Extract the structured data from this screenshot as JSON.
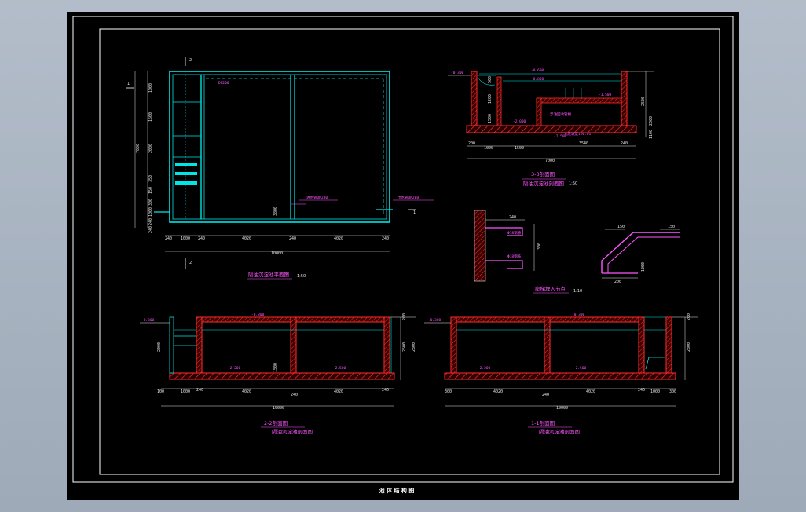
{
  "sheet": {
    "title": "池 体 结 构 图",
    "background": "#000000",
    "viewport_bg": "#a9b4c2"
  },
  "colors": {
    "wall": "#ff2b2b",
    "cyan": "#00e5e5",
    "magenta": "#ff55ff",
    "dim": "#e6e6e6",
    "frame": "#ffffff"
  },
  "plan": {
    "title": "隔油沉淀池平面图",
    "scale": "1:50",
    "section_marks": [
      "2",
      "2",
      "1",
      "1"
    ],
    "dims_bottom": [
      "240",
      "1000",
      "240",
      "4020",
      "240",
      "4020",
      "240"
    ],
    "total_width": "10000",
    "dims_left": [
      "1000",
      "1500",
      "2000",
      "350",
      "150",
      "300",
      "1000",
      "240",
      "240"
    ],
    "total_height": "7000",
    "annotations": [
      "DN200",
      "3800",
      "进水管DN200",
      "出水管DN200"
    ]
  },
  "section3": {
    "title": "3-3剖面图",
    "subtitle": "隔油沉淀池剖面图",
    "scale": "1:50",
    "dims_bottom": [
      "200",
      "1000",
      "1500",
      "3540",
      "240"
    ],
    "total_width": "7000",
    "dims_right": [
      "2500",
      "2000",
      "1100"
    ],
    "dims_left": [
      "500",
      "1200",
      "1500"
    ],
    "elevations": [
      "-0.300",
      "-0.600",
      "-0.800",
      "-1.500",
      "-2.000",
      "-2.500"
    ],
    "note": "浮油回收管槽",
    "note2": "池底坡度i=0.01"
  },
  "detail": {
    "title": "爬梯埋入节点",
    "scale": "1:10",
    "dims": [
      "240",
      "300",
      "150",
      "150",
      "200",
      "1000"
    ],
    "labels": [
      "Φ18钢筋",
      "Φ18钢筋"
    ]
  },
  "section2": {
    "title": "2-2剖面图",
    "subtitle": "隔油沉淀池剖面图",
    "dims_bottom": [
      "100",
      "1000",
      "240",
      "4020",
      "240",
      "4020",
      "240"
    ],
    "total_width": "10000",
    "dims_right": [
      "200",
      "2500",
      "2300"
    ],
    "dims_left": [
      "2000"
    ],
    "elevations": [
      "-0.300",
      "-0.300",
      "-2.200",
      "-2.500"
    ],
    "mid_dim": "1500"
  },
  "section1": {
    "title": "1-1剖面图",
    "subtitle": "隔油沉淀池剖面图",
    "dims_bottom": [
      "300",
      "4020",
      "240",
      "4020",
      "240",
      "1000",
      "300"
    ],
    "total_width": "10000",
    "dims_right": [
      "200",
      "2300"
    ],
    "elevations": [
      "-0.300",
      "-0.300",
      "-2.200",
      "-2.500"
    ]
  }
}
